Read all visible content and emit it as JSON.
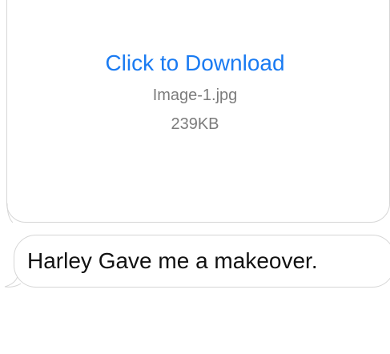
{
  "attachment": {
    "download_label": "Click to Download",
    "file_name": "Image-1.jpg",
    "file_size": "239KB"
  },
  "message": {
    "text": "Harley Gave me a makeover."
  },
  "colors": {
    "link": "#1a7bf2",
    "secondary_text": "#7c7c7c",
    "bubble_border": "#d6d6d6",
    "message_text": "#111111"
  }
}
